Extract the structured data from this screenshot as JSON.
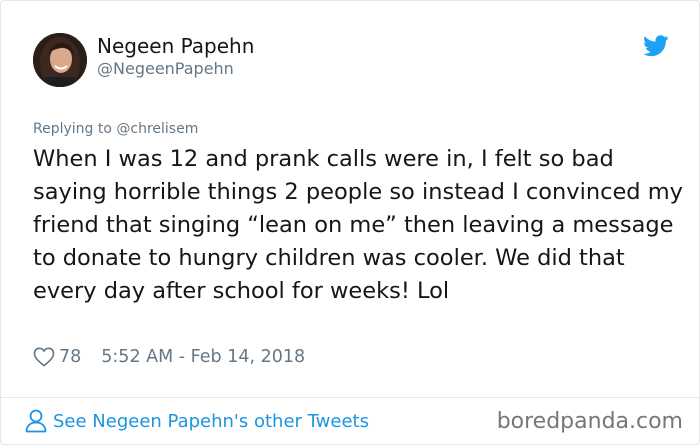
{
  "user": {
    "display_name": "Negeen Papehn",
    "handle": "@NegeenPapehn"
  },
  "reply": {
    "prefix": "Replying to",
    "handle": "@chrelisem"
  },
  "tweet": {
    "text": "When I was 12 and prank calls were in, I felt so bad saying horrible things 2 people so instead I convinced my friend that singing “lean on me” then leaving a message to donate to hungry children was cooler. We did that every day after school for weeks! Lol",
    "like_count": "78",
    "timestamp": "5:52 AM - Feb 14, 2018"
  },
  "footer": {
    "see_more_label": "See Negeen Papehn's other Tweets",
    "watermark": "boredpanda.com"
  },
  "colors": {
    "twitter_blue": "#1da1f2",
    "link_blue": "#1b95e0",
    "muted_gray": "#657786"
  },
  "icons": {
    "brand": "twitter-bird-icon",
    "like": "heart-icon",
    "profile": "person-icon"
  }
}
